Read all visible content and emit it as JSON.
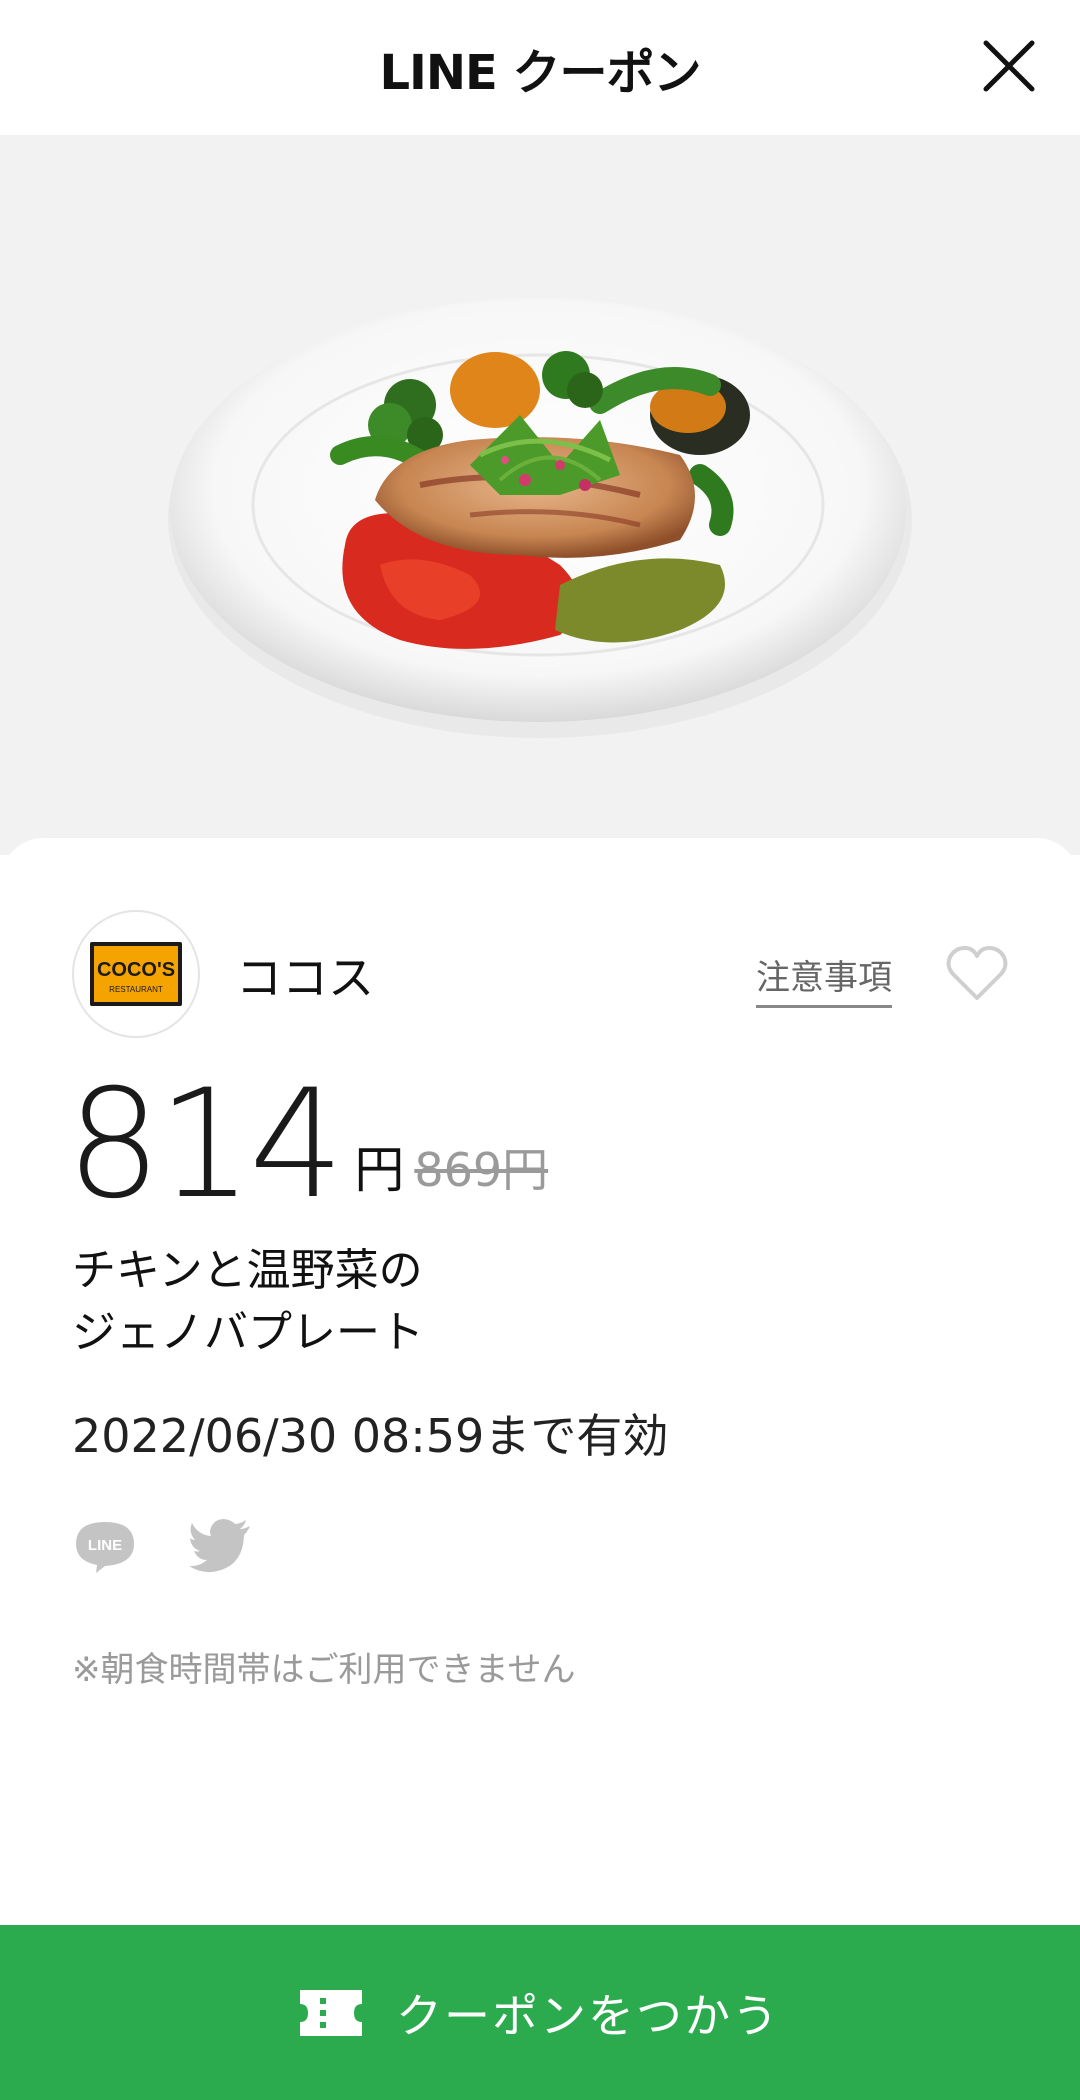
{
  "header": {
    "title": "LINE クーポン"
  },
  "shop": {
    "name": "ココス",
    "logo_text": "COCO'S",
    "logo_subtext": "RESTAURANT"
  },
  "links": {
    "notice": "注意事項"
  },
  "price": {
    "value": "814",
    "unit": "円",
    "original": "869円"
  },
  "item": {
    "line1": "チキンと温野菜の",
    "line2": "ジェノバプレート"
  },
  "validity": "2022/06/30  08:59まで有効",
  "share": {
    "line_label": "LINE"
  },
  "note": "※朝食時間帯はご利用できません",
  "cta": {
    "label": "クーポンをつかう"
  },
  "colors": {
    "accent": "#2bab4e",
    "logo_bg": "#f5a300"
  }
}
